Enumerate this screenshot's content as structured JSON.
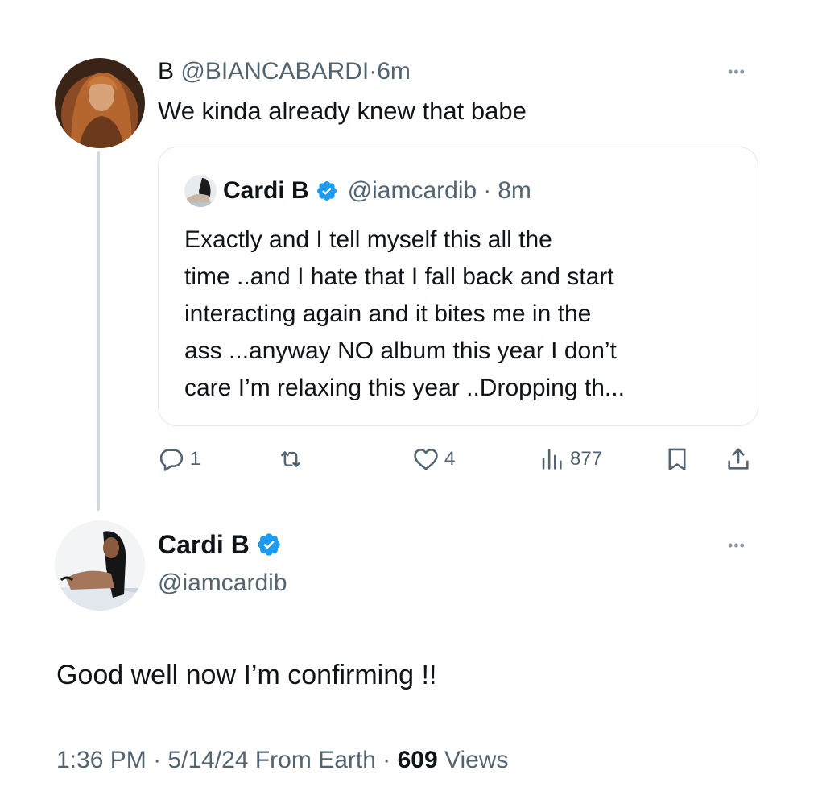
{
  "reply": {
    "display_name": "B",
    "handle": "@BIANCABARDI",
    "separator": "·",
    "time": "6m",
    "text": "We kinda already knew that babe",
    "more_icon": "more-horizontal-icon"
  },
  "quoted_tweet": {
    "display_name": "Cardi B",
    "verified": true,
    "handle": "@iamcardib",
    "separator": "·",
    "time": "8m",
    "text_lines": [
      "Exactly and I tell myself this all the",
      "time ..and I hate that I fall back and start",
      "interacting again and it bites me in the",
      "ass ...anyway NO album this year I don’t",
      "care I’m relaxing this year ..Dropping th..."
    ]
  },
  "actions": {
    "reply": {
      "icon": "reply-icon",
      "count": "1"
    },
    "retweet": {
      "icon": "retweet-icon",
      "count": ""
    },
    "like": {
      "icon": "heart-icon",
      "count": "4"
    },
    "views": {
      "icon": "views-chart-icon",
      "count": "877"
    },
    "bookmark": {
      "icon": "bookmark-icon"
    },
    "share": {
      "icon": "share-icon"
    }
  },
  "main_tweet": {
    "display_name": "Cardi B",
    "verified": true,
    "handle": "@iamcardib",
    "text": "Good well now I’m confirming !!",
    "time": "1:36 PM",
    "separator": "·",
    "date": "5/14/24",
    "source": "From Earth",
    "views_count": "609",
    "views_label": "Views",
    "more_icon": "more-horizontal-icon"
  },
  "colors": {
    "verified_blue": "#1d9bf0",
    "secondary_text": "#536471",
    "primary_text": "#0f1419",
    "border": "#e1e8ed"
  }
}
